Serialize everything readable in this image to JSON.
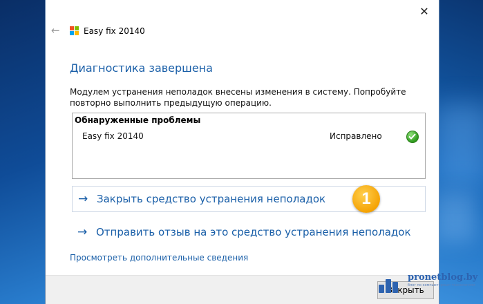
{
  "window": {
    "title": "Easy fix 20140",
    "close_glyph": "✕",
    "back_glyph": "←"
  },
  "content": {
    "heading": "Диагностика завершена",
    "description": "Модулем устранения неполадок внесены изменения в систему. Попробуйте повторно выполнить предыдущую операцию."
  },
  "problems": {
    "header": "Обнаруженные проблемы",
    "items": [
      {
        "name": "Easy fix 20140",
        "status": "Исправлено",
        "status_icon": "check-icon"
      }
    ]
  },
  "actions": {
    "close_troubleshooter": "Закрыть средство устранения неполадок",
    "send_feedback": "Отправить отзыв на это средство устранения неполадок",
    "arrow_glyph": "→"
  },
  "annotation": {
    "badge": "1"
  },
  "links": {
    "more_info": "Просмотреть дополнительные сведения"
  },
  "footer": {
    "close_button": "Закрыть"
  },
  "watermark": {
    "text": "pronetblog.by",
    "subtext": "блог по компьютерным технологиям"
  },
  "colors": {
    "accent": "#1a5fa8",
    "badge": "#f4a000",
    "success": "#2f9b1e",
    "desktop": "#0e57a8"
  }
}
